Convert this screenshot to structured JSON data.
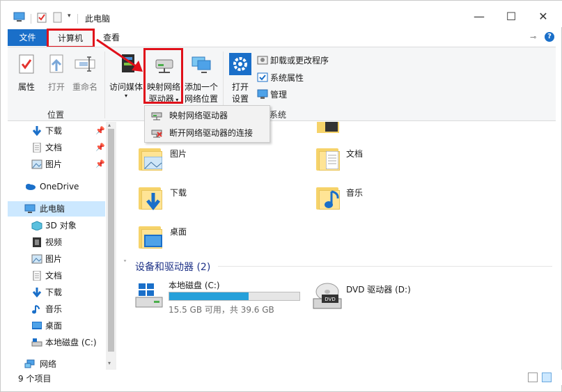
{
  "titlebar": {
    "title": "此电脑",
    "minimize": "—",
    "maximize": "☐",
    "close": "✕"
  },
  "tabs": {
    "file": "文件",
    "computer": "计算机",
    "view": "查看"
  },
  "ribbon": {
    "location_group": {
      "label": "位置",
      "properties": "属性",
      "open": "打开",
      "rename": "重命名"
    },
    "network_group": {
      "access_media": "访问媒体",
      "map_drive_line1": "映射网络",
      "map_drive_line2": "驱动器",
      "add_location_line1": "添加一个",
      "add_location_line2": "网络位置"
    },
    "system_group": {
      "label": "系统",
      "open_settings_line1": "打开",
      "open_settings_line2": "设置",
      "uninstall": "卸载或更改程序",
      "system_properties": "系统属性",
      "manage": "管理"
    }
  },
  "dropdown": {
    "items": [
      {
        "label": "映射网络驱动器"
      },
      {
        "label": "断开网络驱动器的连接"
      }
    ]
  },
  "nav": {
    "quick": [
      {
        "label": "下载"
      },
      {
        "label": "文档"
      },
      {
        "label": "图片"
      }
    ],
    "onedrive": "OneDrive",
    "this_pc": "此电脑",
    "pc_items": [
      {
        "label": "3D 对象"
      },
      {
        "label": "视频"
      },
      {
        "label": "图片"
      },
      {
        "label": "文档"
      },
      {
        "label": "下载"
      },
      {
        "label": "音乐"
      },
      {
        "label": "桌面"
      },
      {
        "label": "本地磁盘 (C:)"
      }
    ],
    "network": "网络"
  },
  "content": {
    "folders": [
      {
        "label": "图片"
      },
      {
        "label": "文档"
      },
      {
        "label": "下载"
      },
      {
        "label": "音乐"
      },
      {
        "label": "桌面"
      }
    ],
    "devices_header": "设备和驱动器 (2)",
    "drive_c": {
      "label": "本地磁盘 (C:)",
      "usage": "15.5 GB 可用，共 39.6 GB",
      "used_fraction": 0.61
    },
    "drive_d": {
      "label": "DVD 驱动器 (D:)"
    }
  },
  "status": {
    "count": "9 个项目"
  },
  "colors": {
    "accent": "#1a6fc9",
    "highlight_red": "#e0101a",
    "selection": "#cce8ff",
    "drive_fill": "#26a0da"
  }
}
